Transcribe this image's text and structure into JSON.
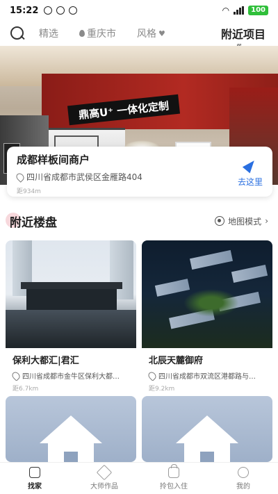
{
  "status": {
    "time": "15:22",
    "battery": "100"
  },
  "nav": {
    "tabs": [
      {
        "label": "精选"
      },
      {
        "label": "重庆市"
      },
      {
        "label": "风格"
      },
      {
        "label": "附近项目"
      }
    ]
  },
  "hero": {
    "sign_text": "鼎高U⁺ 一体化定制"
  },
  "store": {
    "name": "成都样板间商户",
    "address": "四川省成都市武侯区金雁路404",
    "distance": "距934m",
    "go_label": "去这里"
  },
  "section": {
    "title": "附近楼盘",
    "map_mode": "地图模式"
  },
  "listings": [
    {
      "title": "保利大都汇|君汇",
      "address": "四川省成都市金牛区保利大都…",
      "distance": "距6.7km"
    },
    {
      "title": "北辰天麓御府",
      "address": "四川省成都市双流区港都路与…",
      "distance": "距9.2km"
    }
  ],
  "bottom_nav": [
    {
      "label": "找家",
      "icon": "home-icon"
    },
    {
      "label": "大师作品",
      "icon": "pen-icon"
    },
    {
      "label": "拎包入住",
      "icon": "bag-icon"
    },
    {
      "label": "我的",
      "icon": "profile-icon"
    }
  ]
}
